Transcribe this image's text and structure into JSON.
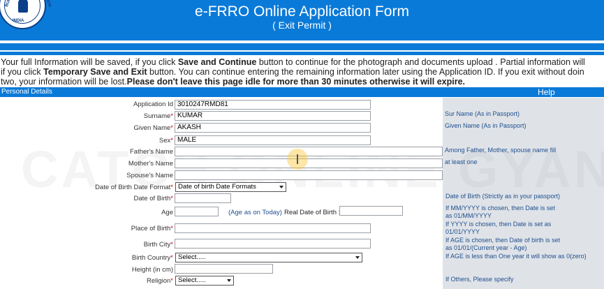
{
  "header": {
    "title": "e-FRRO Online Application Form",
    "subtitle": "( Exit Permit )",
    "emblem": {
      "line1": "INDIA",
      "line2": "BUREAU OF",
      "line3": "IMMIGRATION"
    }
  },
  "info": {
    "l1_a": "Your full Information will be saved, if you click ",
    "l1_b": "Save and Continue",
    "l1_c": " button to continue for the photograph and documents upload . Partial information will",
    "l2_a": "if you click ",
    "l2_b": "Temporary Save and Exit",
    "l2_c": " button. You can continue entering the remaining information later using the Application ID. If you exit without doin",
    "l3_a": "two, your information will be lost.",
    "l3_b": "Please don't leave this page idle for more than 30 minutes otherwise it will expire."
  },
  "section": {
    "title": "Personal Details",
    "help": "Help"
  },
  "fields": {
    "application_id": {
      "label": "Application Id",
      "value": "3010247RMD81"
    },
    "surname": {
      "label": "Surname",
      "value": "KUMAR"
    },
    "given_name": {
      "label": "Given Name",
      "value": "AKASH"
    },
    "sex": {
      "label": "Sex",
      "value": "MALE"
    },
    "father_name": {
      "label": "Father's Name",
      "value": ""
    },
    "mother_name": {
      "label": "Mother's Name",
      "value": ""
    },
    "spouse_name": {
      "label": "Spouse's Name",
      "value": ""
    },
    "dob_format": {
      "label": "Date of Birth Date Format",
      "value": "Date of birth Date Formats"
    },
    "dob": {
      "label": "Date of Birth",
      "value": ""
    },
    "age": {
      "label": "Age",
      "value": "",
      "note": "(Age as on Today)",
      "real_dob_label": "Real Date of Birth :"
    },
    "place_of_birth": {
      "label": "Place of Birth",
      "value": ""
    },
    "birth_city": {
      "label": "Birth City",
      "value": ""
    },
    "birth_country": {
      "label": "Birth Country",
      "value": "Select....."
    },
    "height": {
      "label": "Height (in cm)",
      "value": ""
    },
    "religion": {
      "label": "Religion",
      "value": "Select....."
    }
  },
  "help": {
    "surname": "Sur Name (As in Passport)",
    "given_name": "Given Name (As in Passport)",
    "relatives_1": "Among Father, Mother, spouse name fill",
    "relatives_2": "at least one",
    "dob_title": "Date of Birth (Strictly as in your passport)",
    "dob_1a": "If MM/YYYY is chosen, then Date is set",
    "dob_1b": "as 01/MM/YYYY",
    "dob_2a": "If YYYY is chosen, then Date is set as",
    "dob_2b": "01/01/YYYY",
    "dob_3a": "If AGE is chosen, then Date of birth is set",
    "dob_3b": "as 01/01/(Current year - Age)",
    "dob_4": "If AGE is less than One year it will show as 0(zero)",
    "religion": "If Others, Please specify"
  },
  "watermark": "CATCH ONLINE GYAN",
  "colors": {
    "header_blue": "#0a7ad8",
    "help_bg": "#dfe3e8",
    "help_text": "#1f4e8c",
    "required": "#dd0000"
  }
}
